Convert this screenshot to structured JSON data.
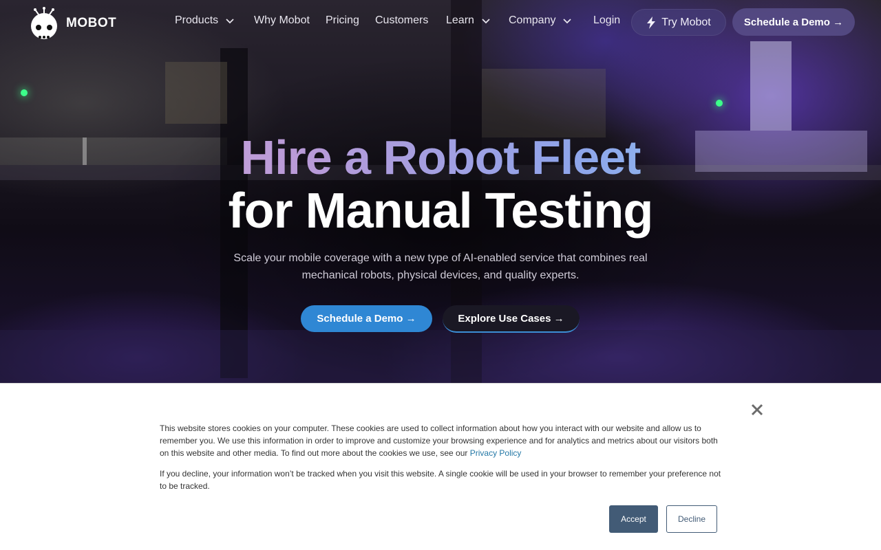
{
  "brand": {
    "name": "MOBOT"
  },
  "nav": {
    "products": "Products",
    "why": "Why Mobot",
    "pricing": "Pricing",
    "customers": "Customers",
    "learn": "Learn",
    "company": "Company",
    "login": "Login",
    "try": "Try Mobot",
    "demo": "Schedule a Demo →"
  },
  "hero": {
    "title_line1": "Hire a Robot Fleet",
    "title_line2": "for Manual Testing",
    "subtitle": "Scale your mobile coverage with a new type of AI-enabled service that combines real mechanical robots, physical devices, and quality experts.",
    "cta_primary": "Schedule a Demo →",
    "cta_secondary": "Explore Use Cases →"
  },
  "cookie": {
    "text1": "This website stores cookies on your computer. These cookies are used to collect information about how you interact with our website and allow us to remember you. We use this information in order to improve and customize your browsing experience and for analytics and metrics about our visitors both on this website and other media. To find out more about the cookies we use, see our",
    "privacy_link": "Privacy Policy",
    "text2": "If you decline, your information won’t be tracked when you visit this website. A single cookie will be used in your browser to remember your preference not to be tracked.",
    "accept": "Accept",
    "decline": "Decline"
  },
  "colors": {
    "primary_cta": "#2f87d4",
    "accept_button": "#425b76",
    "link": "#2478a6"
  }
}
